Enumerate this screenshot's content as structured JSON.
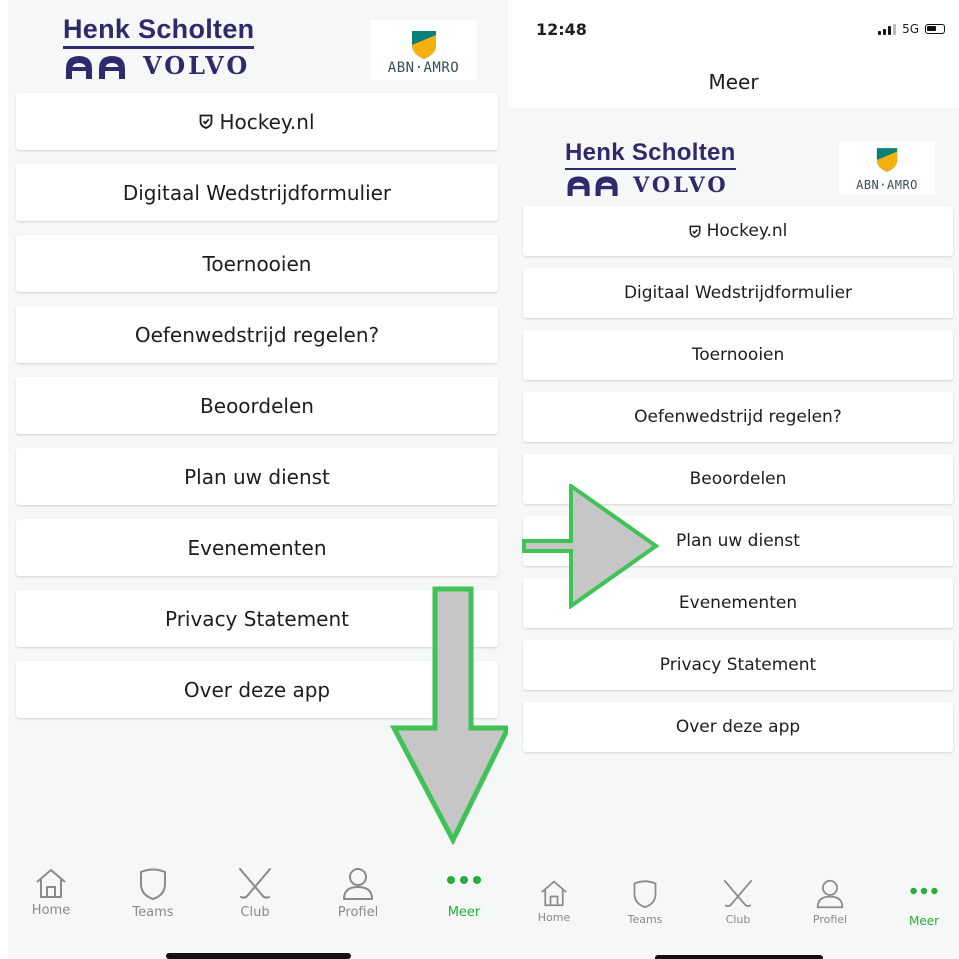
{
  "status": {
    "time": "12:48",
    "network": "5G"
  },
  "nav": {
    "title": "Meer"
  },
  "sponsors": {
    "henk_line1": "Henk Scholten",
    "henk_line2": "VOLVO",
    "abn": "ABN·AMRO"
  },
  "menu": [
    {
      "label": "Hockey.nl",
      "icon": "shield-check-icon"
    },
    {
      "label": "Digitaal Wedstrijdformulier"
    },
    {
      "label": "Toernooien"
    },
    {
      "label": "Oefenwedstrijd regelen?"
    },
    {
      "label": "Beoordelen"
    },
    {
      "label": "Plan uw dienst"
    },
    {
      "label": "Evenementen"
    },
    {
      "label": "Privacy Statement"
    },
    {
      "label": "Over deze app"
    }
  ],
  "tabs": [
    {
      "label": "Home",
      "icon": "home-icon"
    },
    {
      "label": "Teams",
      "icon": "shield-icon"
    },
    {
      "label": "Club",
      "icon": "crossed-sticks-icon"
    },
    {
      "label": "Profiel",
      "icon": "person-icon"
    },
    {
      "label": "Meer",
      "icon": "more-dots-icon",
      "active": true
    }
  ],
  "colors": {
    "accent": "#27ae3a",
    "arrow_fill": "#c6c6c6",
    "arrow_stroke": "#3fc256",
    "brand_navy": "#2e2a6b"
  }
}
